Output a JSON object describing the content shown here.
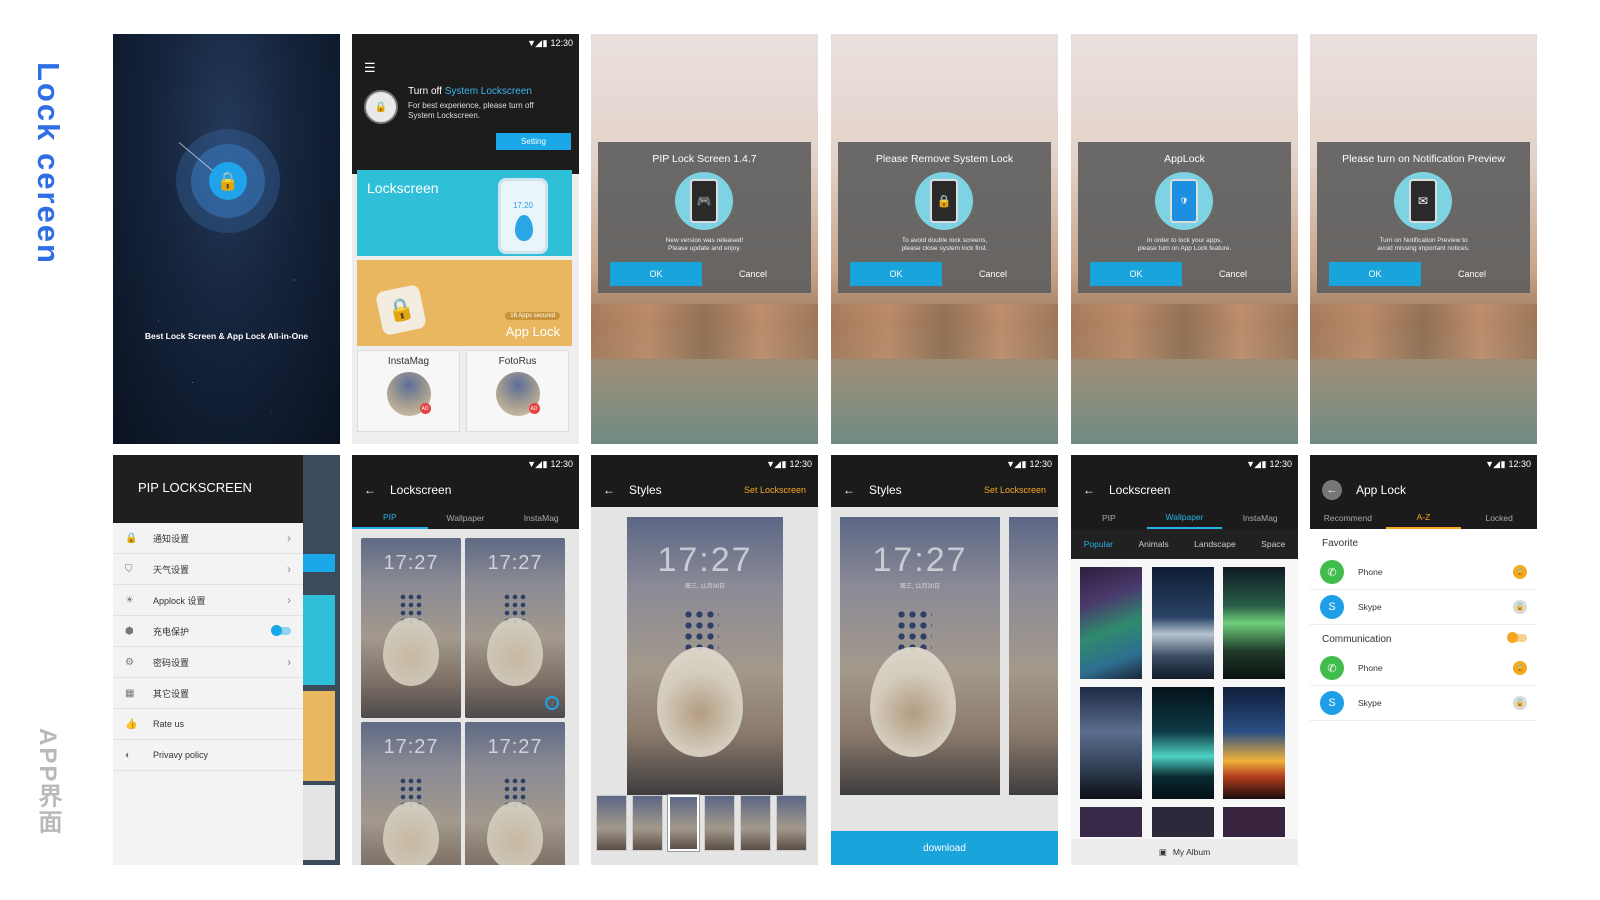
{
  "labels": {
    "section_title": "Lock cereen",
    "section_subtitle": "APP界面"
  },
  "status": {
    "time": "12:30",
    "signal": "▼◢ ▮"
  },
  "splash": {
    "tagline": "Best Lock Screen & App Lock All-in-One"
  },
  "home": {
    "banner_title_prefix": "Turn off ",
    "banner_title_highlight": "System Lockscreen",
    "banner_desc": "For best experience, please turn off System Lockscreen.",
    "setting_button": "Setting",
    "lockscreen_card": "Lockscreen",
    "phone_time": "17:20",
    "applock_badge": "16 Apps secured",
    "applock_card": "App Lock",
    "mini_cards": [
      "InstaMag",
      "FotoRus"
    ],
    "ad_badge": "AD"
  },
  "dialogs": [
    {
      "title": "PIP Lock Screen  1.4.7",
      "message": "New version was released!\nPlease update and enjoy.",
      "ok": "OK",
      "cancel": "Cancel",
      "icon": "gamepad-icon"
    },
    {
      "title": "Please Remove System Lock",
      "message": "To avoid double lock screens,\nplease close system lock first.",
      "ok": "OK",
      "cancel": "Cancel",
      "icon": "lock-icon"
    },
    {
      "title": "AppLock",
      "message": "In order to lock your apps,\nplease turn on App Lock feature.",
      "ok": "OK",
      "cancel": "Cancel",
      "icon": "shield-icon"
    },
    {
      "title": "Please turn on Notification Preview",
      "message": "Turn on Notification Preview to\navoid missing important notices.",
      "ok": "OK",
      "cancel": "Cancel",
      "icon": "notification-icon"
    }
  ],
  "settings": {
    "title": "PIP LOCKSCREEN",
    "items": [
      "通知设置",
      "天气设置",
      "Applock 设置",
      "充电保护",
      "密码设置",
      "其它设置",
      "Rate us",
      "Privavy policy"
    ]
  },
  "lockscreen": {
    "title": "Lockscreen",
    "tabs": [
      "PIP",
      "Wallpaper",
      "InstaMag"
    ],
    "clock": "17:27"
  },
  "styles": {
    "title": "Styles",
    "action": "Set  Lockscreen",
    "clock": "17:27",
    "date": "周三, 11月30日",
    "download": "download"
  },
  "wallpaper": {
    "title": "Lockscreen",
    "tabs": [
      "PIP",
      "Wallpaper",
      "InstaMag"
    ],
    "subtabs": [
      "Popular",
      "Animals",
      "Landscape",
      "Space"
    ],
    "album": "My Album"
  },
  "applock": {
    "title": "App Lock",
    "tabs": [
      "Recommend",
      "A-Z",
      "Locked"
    ],
    "favorite": "Favorite",
    "communication": "Communication",
    "apps": [
      "Phone",
      "Skype",
      "Phone",
      "Skype"
    ]
  }
}
